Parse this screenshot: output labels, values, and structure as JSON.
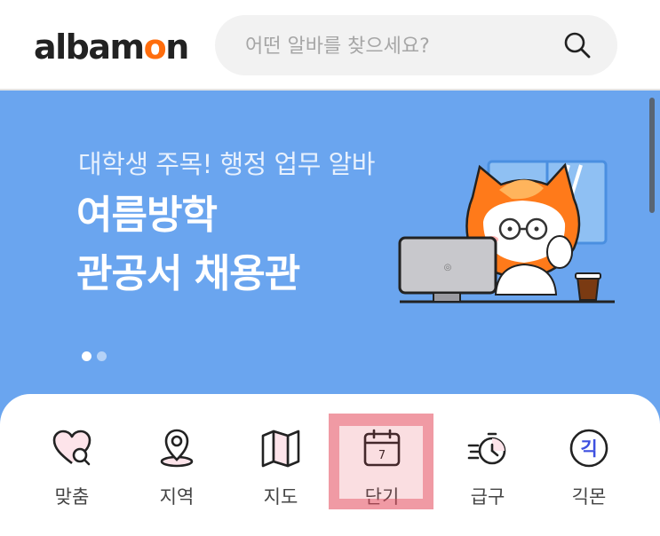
{
  "header": {
    "logo_text": "albamon",
    "search_placeholder": "어떤 알바를 찾으세요?"
  },
  "banner": {
    "subtitle": "대학생 주목! 행정 업무 알바",
    "title_line1": "여름방학",
    "title_line2": "관공서 채용관",
    "page_count": 2,
    "active_page": 1
  },
  "nav": {
    "items": [
      {
        "label": "맞춤",
        "icon": "heart-search-icon"
      },
      {
        "label": "지역",
        "icon": "location-pin-icon"
      },
      {
        "label": "지도",
        "icon": "map-icon"
      },
      {
        "label": "단기",
        "icon": "calendar-icon",
        "calendar_day": "7"
      },
      {
        "label": "급구",
        "icon": "fast-timer-icon"
      },
      {
        "label": "긱몬",
        "icon": "gigmon-icon",
        "icon_text": "긱"
      }
    ]
  },
  "colors": {
    "brand_orange": "#ff6d0d",
    "banner_blue": "#6aa5ef",
    "highlight": "#e4465a",
    "accent_blue": "#3d50e0"
  }
}
